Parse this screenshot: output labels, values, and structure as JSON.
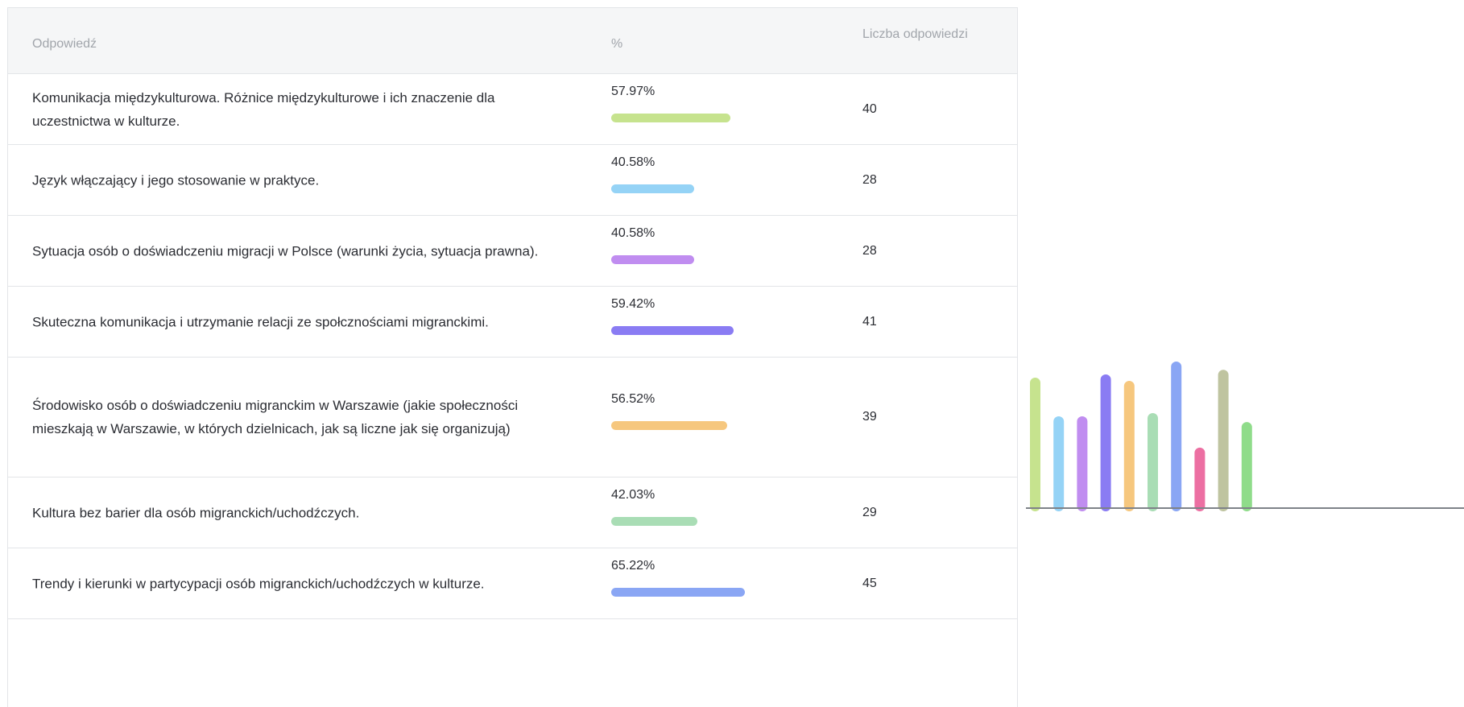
{
  "table": {
    "headers": {
      "answer": "Odpowiedź",
      "percent": "%",
      "count": "Liczba odpowiedzi"
    },
    "rows": [
      {
        "answer": "Komunikacja międzykulturowa. Różnice międzykulturowe i ich znaczenie dla uczestnictwa w kulturze.",
        "percent": "57.97%",
        "count": "40",
        "color": "#c6e38e"
      },
      {
        "answer": "Język włączający i jego stosowanie w praktyce.",
        "percent": "40.58%",
        "count": "28",
        "color": "#95d3f6"
      },
      {
        "answer": "Sytuacja osób o doświadczeniu migracji w Polsce (warunki życia, sytuacja prawna).",
        "percent": "40.58%",
        "count": "28",
        "color": "#c08df0"
      },
      {
        "answer": "Skuteczna komunikacja i utrzymanie relacji ze społcznościami migranckimi.",
        "percent": "59.42%",
        "count": "41",
        "color": "#8a7cf3"
      },
      {
        "answer": "Środowisko osób o doświadczeniu migranckim w Warszawie (jakie społeczności mieszkają w Warszawie, w których dzielnicach, jak są liczne jak się organizują)",
        "percent": "56.52%",
        "count": "39",
        "color": "#f6c77e"
      },
      {
        "answer": "Kultura bez barier dla osób migranckich/uchodźczych.",
        "percent": "42.03%",
        "count": "29",
        "color": "#a9ddb5"
      },
      {
        "answer": "Trendy i kierunki w partycypacji osób migranckich/uchodźczych w kulturze.",
        "percent": "65.22%",
        "count": "45",
        "color": "#8aa6f4"
      }
    ]
  },
  "chart_data": {
    "type": "bar",
    "x_axis_baseline": true,
    "grid": false,
    "series": [
      {
        "values": [
          57.97,
          40.58,
          40.58,
          59.42,
          56.52,
          42.03,
          65.22,
          26.5,
          61.5,
          38
        ],
        "colors": [
          "#c6e38e",
          "#95d3f6",
          "#c08df0",
          "#8a7cf3",
          "#f6c77e",
          "#a9ddb5",
          "#8aa6f4",
          "#ec6fa2",
          "#bfc4a0",
          "#8fdc8a"
        ]
      }
    ],
    "ylim": [
      0,
      100
    ]
  }
}
